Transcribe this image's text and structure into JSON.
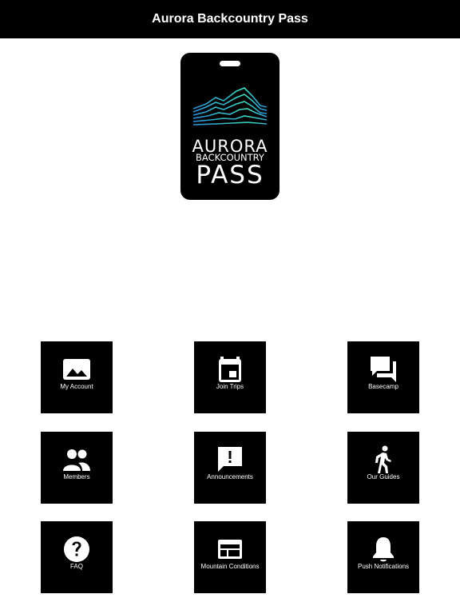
{
  "header": {
    "title": "Aurora Backcountry Pass"
  },
  "logo": {
    "line1": "AURORA",
    "line2": "BACKCOUNTRY",
    "line3": "PASS"
  },
  "colors": {
    "accent_teal": "#3fe0c0",
    "accent_blue": "#2a8fd6",
    "tile_bg": "#000000"
  },
  "menu": {
    "items": [
      {
        "label": "My Account",
        "icon": "image-icon"
      },
      {
        "label": "Join Trips",
        "icon": "calendar-icon"
      },
      {
        "label": "Basecamp",
        "icon": "chat-bubbles-icon"
      },
      {
        "label": "Members",
        "icon": "people-icon"
      },
      {
        "label": "Announcements",
        "icon": "announcement-icon"
      },
      {
        "label": "Our Guides",
        "icon": "hiker-icon"
      },
      {
        "label": "FAQ",
        "icon": "help-icon"
      },
      {
        "label": "Mountain Conditions",
        "icon": "web-panel-icon"
      },
      {
        "label": "Push Notifications",
        "icon": "bell-icon"
      }
    ]
  }
}
